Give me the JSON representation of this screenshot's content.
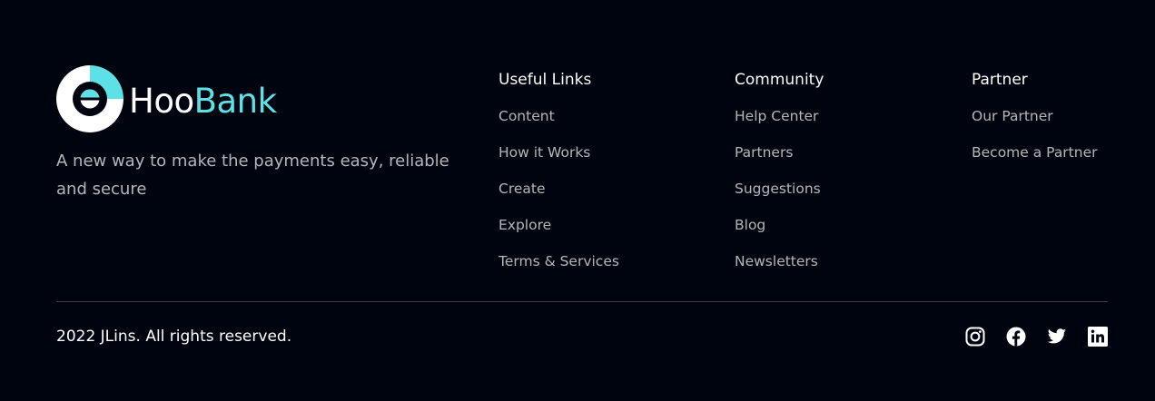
{
  "brand": {
    "name_part1": "Hoo",
    "name_part2": "Bank",
    "tagline": "A new way to make the payments easy, reliable and secure",
    "accent_color": "#5ce1e6",
    "background_color": "#00040f"
  },
  "columns": [
    {
      "title": "Useful Links",
      "links": [
        "Content",
        "How it Works",
        "Create",
        "Explore",
        "Terms & Services"
      ]
    },
    {
      "title": "Community",
      "links": [
        "Help Center",
        "Partners",
        "Suggestions",
        "Blog",
        "Newsletters"
      ]
    },
    {
      "title": "Partner",
      "links": [
        "Our Partner",
        "Become a Partner"
      ]
    }
  ],
  "footer": {
    "copyright": "2022 JLins. All rights reserved.",
    "social_icons": [
      "instagram-icon",
      "facebook-icon",
      "twitter-icon",
      "linkedin-icon"
    ]
  }
}
